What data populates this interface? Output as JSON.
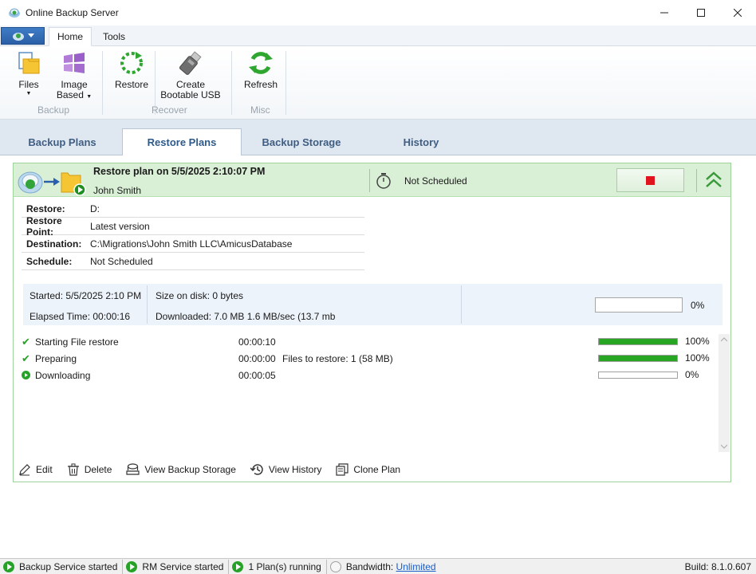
{
  "window": {
    "title": "Online Backup Server"
  },
  "ribbon": {
    "tabs": [
      {
        "label": "Home",
        "active": true
      },
      {
        "label": "Tools",
        "active": false
      }
    ],
    "buttons": {
      "files": "Files",
      "image_based_line1": "Image",
      "image_based_line2": "Based",
      "restore": "Restore",
      "create_usb_line1": "Create",
      "create_usb_line2": "Bootable USB",
      "refresh": "Refresh"
    },
    "groups": {
      "backup": "Backup",
      "recover": "Recover",
      "misc": "Misc"
    }
  },
  "main_tabs": [
    {
      "label": "Backup Plans",
      "active": false
    },
    {
      "label": "Restore Plans",
      "active": true
    },
    {
      "label": "Backup Storage",
      "active": false
    },
    {
      "label": "History",
      "active": false
    }
  ],
  "plan": {
    "title": "Restore plan on 5/5/2025 2:10:07 PM",
    "user": "John Smith",
    "schedule_status": "Not Scheduled",
    "details": [
      {
        "label": "Restore:",
        "value": "D:"
      },
      {
        "label": "Restore Point:",
        "value": "Latest version"
      },
      {
        "label": "Destination:",
        "value": "C:\\Migrations\\John Smith LLC\\AmicusDatabase"
      },
      {
        "label": "Schedule:",
        "value": "Not Scheduled"
      }
    ],
    "stats": {
      "started": "Started: 5/5/2025 2:10 PM",
      "elapsed": "Elapsed Time: 00:00:16",
      "size_on_disk": "Size on disk: 0 bytes",
      "downloaded": "Downloaded: 7.0 MB  1.6 MB/sec (13.7 mb",
      "overall_percent": "0%",
      "overall_progress": 0
    },
    "steps": [
      {
        "label": "Starting File restore",
        "time": "00:00:10",
        "info": "",
        "percent": "100%",
        "progress": 1.0,
        "status": "done"
      },
      {
        "label": "Preparing",
        "time": "00:00:00",
        "info": "Files to restore: 1 (58 MB)",
        "percent": "100%",
        "progress": 1.0,
        "status": "done"
      },
      {
        "label": "Downloading",
        "time": "00:00:05",
        "info": "",
        "percent": "0%",
        "progress": 0.0,
        "status": "running"
      }
    ],
    "actions": {
      "edit": "Edit",
      "delete": "Delete",
      "view_storage": "View Backup Storage",
      "view_history": "View History",
      "clone": "Clone Plan"
    }
  },
  "statusbar": {
    "backup_service": "Backup Service started",
    "rm_service": "RM Service started",
    "plans_running": "1 Plan(s) running",
    "bandwidth_label": "Bandwidth:",
    "bandwidth_value": "Unlimited",
    "build": "Build: 8.1.0.607"
  },
  "colors": {
    "accent_blue": "#2e5a8a",
    "success_green": "#28a523",
    "stop_red": "#e0141c",
    "plan_header_bg": "#d9f0d6"
  }
}
